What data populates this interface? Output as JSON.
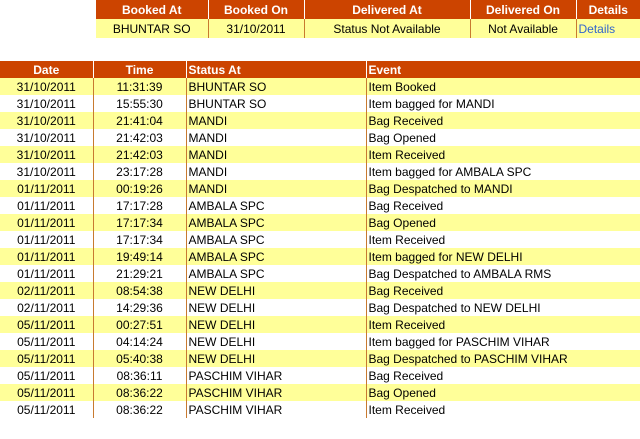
{
  "summary": {
    "headers": [
      "Booked At",
      "Booked On",
      "Delivered At",
      "Delivered On",
      "Details"
    ],
    "row": {
      "booked_at": "BHUNTAR SO",
      "booked_on": "31/10/2011",
      "delivered_at": "Status Not Available",
      "delivered_on": "Not Available",
      "details_link": "Details"
    }
  },
  "events": {
    "headers": [
      "Date",
      "Time",
      "Status At",
      "Event"
    ],
    "rows": [
      [
        "31/10/2011",
        "11:31:39",
        "BHUNTAR SO",
        "Item Booked"
      ],
      [
        "31/10/2011",
        "15:55:30",
        "BHUNTAR SO",
        "Item bagged for MANDI"
      ],
      [
        "31/10/2011",
        "21:41:04",
        "MANDI",
        "Bag Received"
      ],
      [
        "31/10/2011",
        "21:42:03",
        "MANDI",
        "Bag Opened"
      ],
      [
        "31/10/2011",
        "21:42:03",
        "MANDI",
        "Item Received"
      ],
      [
        "31/10/2011",
        "23:17:28",
        "MANDI",
        "Item bagged for AMBALA SPC"
      ],
      [
        "01/11/2011",
        "00:19:26",
        "MANDI",
        "Bag Despatched to MANDI"
      ],
      [
        "01/11/2011",
        "17:17:28",
        "AMBALA SPC",
        "Bag Received"
      ],
      [
        "01/11/2011",
        "17:17:34",
        "AMBALA SPC",
        "Bag Opened"
      ],
      [
        "01/11/2011",
        "17:17:34",
        "AMBALA SPC",
        "Item Received"
      ],
      [
        "01/11/2011",
        "19:49:14",
        "AMBALA SPC",
        "Item bagged for NEW DELHI"
      ],
      [
        "01/11/2011",
        "21:29:21",
        "AMBALA SPC",
        "Bag Despatched to AMBALA RMS"
      ],
      [
        "02/11/2011",
        "08:54:38",
        "NEW DELHI",
        "Bag Received"
      ],
      [
        "02/11/2011",
        "14:29:36",
        "NEW DELHI",
        "Bag Despatched to NEW DELHI"
      ],
      [
        "05/11/2011",
        "00:27:51",
        "NEW DELHI",
        "Item Received"
      ],
      [
        "05/11/2011",
        "04:14:24",
        "NEW DELHI",
        "Item bagged for PASCHIM VIHAR"
      ],
      [
        "05/11/2011",
        "05:40:38",
        "NEW DELHI",
        "Bag Despatched to PASCHIM VIHAR"
      ],
      [
        "05/11/2011",
        "08:36:11",
        "PASCHIM VIHAR",
        "Bag Received"
      ],
      [
        "05/11/2011",
        "08:36:22",
        "PASCHIM VIHAR",
        "Bag Opened"
      ],
      [
        "05/11/2011",
        "08:36:22",
        "PASCHIM VIHAR",
        "Item Received"
      ]
    ]
  }
}
